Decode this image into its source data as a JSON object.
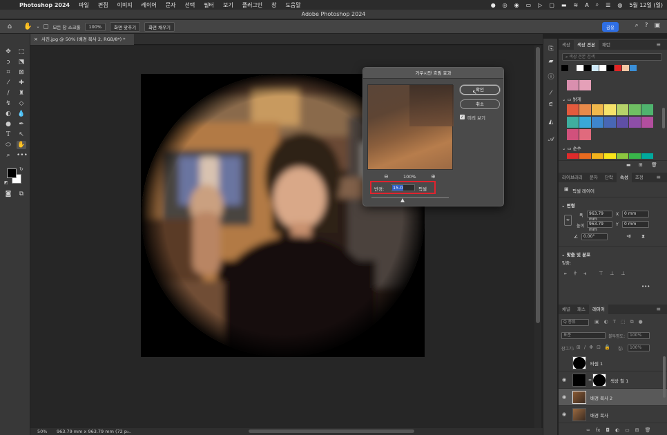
{
  "menubar": {
    "apple": "",
    "app": "Photoshop 2024",
    "items": [
      "파일",
      "편집",
      "이미지",
      "레이어",
      "문자",
      "선택",
      "필터",
      "보기",
      "플러그인",
      "창",
      "도움말"
    ],
    "date": "5월 12일 (일)"
  },
  "window_title": "Adobe Photoshop 2024",
  "options": {
    "scroll_all_label": "모든 창 스크롤",
    "zoom_value": "100%",
    "fit_screen_label": "화면 맞추기",
    "fill_screen_label": "화면 채우기",
    "share_label": "공유"
  },
  "document": {
    "tab_title": "사진.jpg @ 50% (배경 복사 2, RGB/8*) *"
  },
  "status": {
    "zoom": "50%",
    "info": "963.79 mm x 963.79 mm (72 p...",
    "arrow": "›"
  },
  "dialog": {
    "title": "가우시안 흐림 효과",
    "ok_label": "확인",
    "cancel_label": "취소",
    "preview_label": "미리 보기",
    "preview_checked": true,
    "zoom": "100%",
    "radius_label": "반경:",
    "radius_value": "15.0",
    "radius_unit": "픽셀",
    "highlight_color": "#e0232e"
  },
  "swatches_panel": {
    "tabs": [
      "색상",
      "색상 견본",
      "패턴"
    ],
    "search_placeholder": "색상 견본 검색",
    "group_bright": "밝게",
    "group_pure": "순수",
    "top_row": [
      "#000000",
      "#3a3a3a",
      "#ffffff",
      "#000000",
      "#cfe9f9",
      "#ffffff",
      "#000000",
      "#e32424",
      "#f3c7a3",
      "#3a8fd8"
    ],
    "bright_rows": [
      [
        "#e35a3d",
        "#e88a4a",
        "#f0b84c",
        "#f6e26a",
        "#b6d36a",
        "#6fbf63",
        "#4fb36e"
      ],
      [
        "#3fae9f",
        "#3aa8d8",
        "#3e86cd",
        "#4867b5",
        "#5f4fa6",
        "#8d4ea7",
        "#b24e9e"
      ],
      [
        "#d1517c",
        "#e06a7d"
      ]
    ],
    "pure_row": [
      "#e02b2b",
      "#e86a1f",
      "#f3b31c",
      "#f9e51a",
      "#8cc63f",
      "#39b54a",
      "#00a99d"
    ],
    "pink_row": [
      "#d98fae",
      "#e5a0b8"
    ]
  },
  "properties_panel": {
    "tabs": [
      "라이브러리",
      "문자",
      "단락",
      "속성",
      "조정"
    ],
    "active_tab": "속성",
    "layer_type": "픽셀 레이어",
    "transform_header": "변형",
    "w_label": "폭",
    "w_value": "963.79 mm",
    "x_label": "X",
    "x_value": "0 mm",
    "h_label": "높이",
    "h_value": "963.79 mm",
    "y_label": "Y",
    "y_value": "0 mm",
    "angle_value": "0.00°",
    "align_header": "맞춤 및 분포",
    "align_label": "맞춤:",
    "more": "•••"
  },
  "layers_panel": {
    "tabs": [
      "채널",
      "패스",
      "레이어"
    ],
    "active_tab": "레이어",
    "filter_label": "Q 종류",
    "blend_mode": "표준",
    "opacity_label": "불투명도:",
    "opacity_value": "100%",
    "lock_label": "잠그기:",
    "fill_label": "칠:",
    "fill_value": "100%",
    "layers": [
      {
        "name": "타원 1",
        "visible": false,
        "selected": false
      },
      {
        "name": "색상 칠 1",
        "visible": true,
        "selected": false
      },
      {
        "name": "배경 복사 2",
        "visible": true,
        "selected": true
      },
      {
        "name": "배경 복사",
        "visible": true,
        "selected": false
      }
    ]
  }
}
